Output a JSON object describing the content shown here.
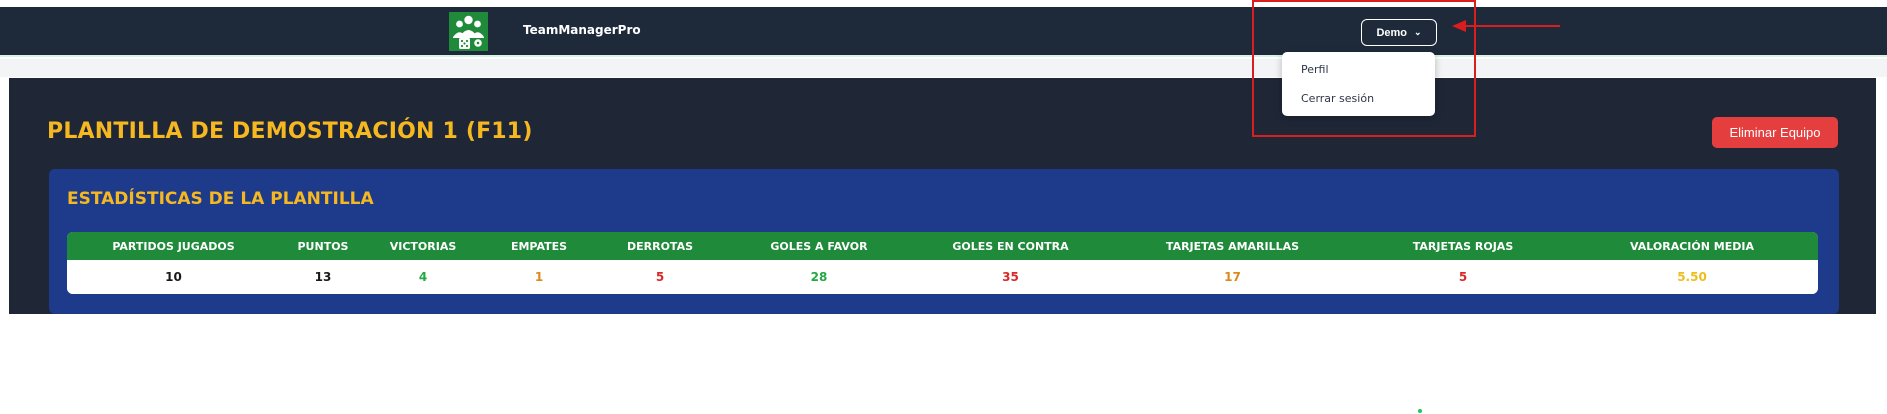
{
  "navbar": {
    "brand": "TeamManagerPro",
    "logo_icon": "team-logo-icon",
    "user_button": {
      "label": "Demo",
      "icon": "chevron-down-icon"
    }
  },
  "user_menu": {
    "items": [
      {
        "label": "Perfil"
      },
      {
        "label": "Cerrar sesión"
      }
    ]
  },
  "page": {
    "title": "PLANTILLA DE DEMOSTRACIÓN 1 (F11)",
    "delete_button": "Eliminar Equipo"
  },
  "stats": {
    "title": "ESTADÍSTICAS DE LA PLANTILLA",
    "columns": [
      {
        "header": "PARTIDOS JUGADOS",
        "value": "10",
        "color": "#1a1a1a"
      },
      {
        "header": "PUNTOS",
        "value": "13",
        "color": "#1a1a1a"
      },
      {
        "header": "VICTORIAS",
        "value": "4",
        "color": "#22a845"
      },
      {
        "header": "EMPATES",
        "value": "1",
        "color": "#dd8a1c"
      },
      {
        "header": "DERROTAS",
        "value": "5",
        "color": "#d92a2a"
      },
      {
        "header": "GOLES A FAVOR",
        "value": "28",
        "color": "#22a845"
      },
      {
        "header": "GOLES EN CONTRA",
        "value": "35",
        "color": "#d92a2a"
      },
      {
        "header": "TARJETAS AMARILLAS",
        "value": "17",
        "color": "#dd8a1c"
      },
      {
        "header": "TARJETAS ROJAS",
        "value": "5",
        "color": "#d92a2a"
      },
      {
        "header": "VALORACIÓN MEDIA",
        "value": "5.50",
        "color": "#eebd1e"
      }
    ]
  },
  "colors": {
    "navbar_bg": "#1e2a3a",
    "main_bg": "#1f2737",
    "panel_bg": "#1e3a8a",
    "accent": "#f5b820",
    "table_header": "#1f8a3a",
    "danger": "#e53e3e",
    "annotation": "#d81e1e"
  }
}
